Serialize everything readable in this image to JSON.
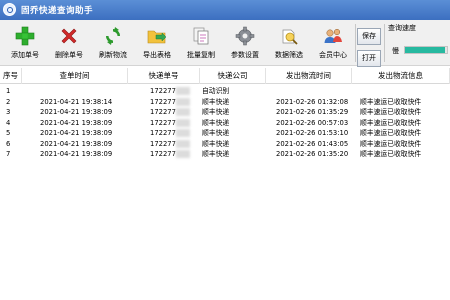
{
  "window": {
    "title": "固乔快递查询助手"
  },
  "toolbar": {
    "buttons": [
      {
        "label": "添加单号",
        "icon": "plus-icon"
      },
      {
        "label": "删除单号",
        "icon": "delete-x-icon"
      },
      {
        "label": "刷新物流",
        "icon": "refresh-icon"
      },
      {
        "label": "导出表格",
        "icon": "folder-export-icon"
      },
      {
        "label": "批量复制",
        "icon": "copy-icon"
      },
      {
        "label": "参数设置",
        "icon": "gear-icon"
      },
      {
        "label": "数据筛选",
        "icon": "filter-icon"
      },
      {
        "label": "会员中心",
        "icon": "users-icon"
      }
    ],
    "save_label": "保存",
    "open_label": "打开",
    "speed_label": "查询速度",
    "speed_slow": "慢",
    "speed_value": 0.95
  },
  "table": {
    "columns": [
      "序号",
      "查单时间",
      "快递单号",
      "快递公司",
      "发出物流时间",
      "发出物流信息"
    ],
    "rows": [
      {
        "no": "1",
        "time": "",
        "tracking": "172277",
        "company": "自动识别",
        "ship_time": "",
        "info": ""
      },
      {
        "no": "2",
        "time": "2021-04-21 19:38:14",
        "tracking": "172277",
        "company": "顺丰快递",
        "ship_time": "2021-02-26 01:32:08",
        "info": "顺丰速运已收取快件"
      },
      {
        "no": "3",
        "time": "2021-04-21 19:38:09",
        "tracking": "172277",
        "company": "顺丰快递",
        "ship_time": "2021-02-26 01:35:29",
        "info": "顺丰速运已收取快件"
      },
      {
        "no": "4",
        "time": "2021-04-21 19:38:09",
        "tracking": "172277",
        "company": "顺丰快递",
        "ship_time": "2021-02-26 00:57:03",
        "info": "顺丰速运已收取快件"
      },
      {
        "no": "5",
        "time": "2021-04-21 19:38:09",
        "tracking": "172277",
        "company": "顺丰快递",
        "ship_time": "2021-02-26 01:53:10",
        "info": "顺丰速运已收取快件"
      },
      {
        "no": "6",
        "time": "2021-04-21 19:38:09",
        "tracking": "172277",
        "company": "顺丰快递",
        "ship_time": "2021-02-26 01:43:05",
        "info": "顺丰速运已收取快件"
      },
      {
        "no": "7",
        "time": "2021-04-21 19:38:09",
        "tracking": "172277",
        "company": "顺丰快递",
        "ship_time": "2021-02-26 01:35:20",
        "info": "顺丰速运已收取快件"
      }
    ]
  },
  "colors": {
    "titlebar": "#3c6fc0",
    "speed_fill": "#27b9a0"
  }
}
